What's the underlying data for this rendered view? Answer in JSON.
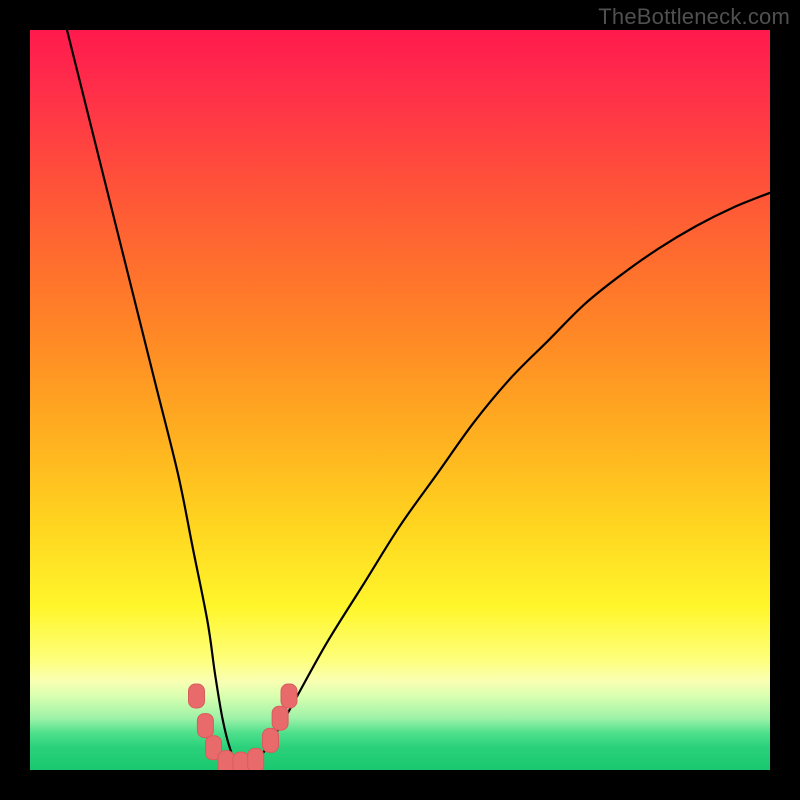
{
  "attribution": "TheBottleneck.com",
  "colors": {
    "frame": "#000000",
    "curve_stroke": "#000000",
    "marker_fill": "#e86a6a",
    "marker_stroke": "#d95c5c"
  },
  "chart_data": {
    "type": "line",
    "title": "",
    "xlabel": "",
    "ylabel": "",
    "xlim": [
      0,
      100
    ],
    "ylim": [
      0,
      100
    ],
    "grid": false,
    "legend": false,
    "series": [
      {
        "name": "bottleneck-curve",
        "x": [
          5,
          8,
          11,
          14,
          17,
          20,
          22,
          24,
          25,
          26,
          27,
          28,
          30,
          32,
          35,
          40,
          45,
          50,
          55,
          60,
          65,
          70,
          75,
          80,
          85,
          90,
          95,
          100
        ],
        "y": [
          100,
          88,
          76,
          64,
          52,
          40,
          30,
          20,
          13,
          7,
          3,
          1,
          1,
          3,
          8,
          17,
          25,
          33,
          40,
          47,
          53,
          58,
          63,
          67,
          70.5,
          73.5,
          76,
          78
        ]
      }
    ],
    "markers": [
      {
        "name": "marker-left-1",
        "x": 22.5,
        "y": 10.0
      },
      {
        "name": "marker-left-2",
        "x": 23.7,
        "y": 6.0
      },
      {
        "name": "marker-left-3",
        "x": 24.8,
        "y": 3.0
      },
      {
        "name": "marker-bottom-1",
        "x": 26.5,
        "y": 1.0
      },
      {
        "name": "marker-bottom-2",
        "x": 28.5,
        "y": 0.8
      },
      {
        "name": "marker-bottom-3",
        "x": 30.5,
        "y": 1.3
      },
      {
        "name": "marker-right-1",
        "x": 32.5,
        "y": 4.0
      },
      {
        "name": "marker-right-2",
        "x": 33.8,
        "y": 7.0
      },
      {
        "name": "marker-right-3",
        "x": 35.0,
        "y": 10.0
      }
    ]
  }
}
